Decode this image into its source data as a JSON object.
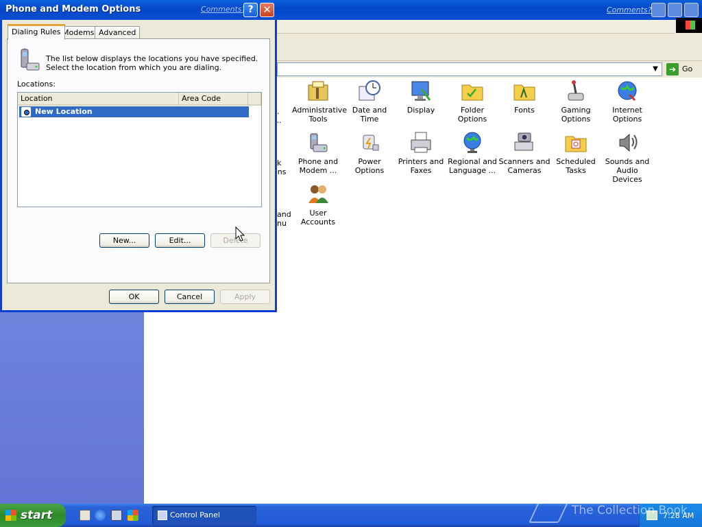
{
  "control_panel": {
    "comments_link": "Comments?",
    "address_go_label": "Go",
    "items": [
      {
        "label": "Administrative Tools",
        "icon": "administrative-tools-icon"
      },
      {
        "label": "Date and Time",
        "icon": "date-time-icon"
      },
      {
        "label": "Display",
        "icon": "display-icon"
      },
      {
        "label": "Folder Options",
        "icon": "folder-options-icon"
      },
      {
        "label": "Fonts",
        "icon": "fonts-icon"
      },
      {
        "label": "Gaming Options",
        "icon": "gaming-options-icon"
      },
      {
        "label": "Internet Options",
        "icon": "internet-options-icon"
      },
      {
        "label": "Phone and Modem ...",
        "icon": "phone-modem-icon"
      },
      {
        "label": "Power Options",
        "icon": "power-options-icon"
      },
      {
        "label": "Printers and Faxes",
        "icon": "printers-faxes-icon"
      },
      {
        "label": "Regional and Language ...",
        "icon": "regional-language-icon"
      },
      {
        "label": "Scanners and Cameras",
        "icon": "scanners-cameras-icon"
      },
      {
        "label": "Scheduled Tasks",
        "icon": "scheduled-tasks-icon"
      },
      {
        "label": "Sounds and Audio Devices",
        "icon": "sounds-audio-icon"
      },
      {
        "label": "User Accounts",
        "icon": "user-accounts-icon"
      }
    ],
    "partial_labels": {
      "row1": ".",
      "row1b": "...",
      "row2a": "k",
      "row2b": "ons",
      "row3a": "and",
      "row3b": "nu"
    }
  },
  "dialog": {
    "title": "Phone and Modem Options",
    "comments_link": "Comments?",
    "help_label": "?",
    "close_label": "✕",
    "tabs": [
      "Dialing Rules",
      "Modems",
      "Advanced"
    ],
    "description": "The list below displays the locations you have specified. Select the location from which you are dialing.",
    "locations_label": "Locations:",
    "columns": [
      "Location",
      "Area Code"
    ],
    "rows": [
      {
        "location": "New Location",
        "area_code": ""
      }
    ],
    "buttons": {
      "new": "New...",
      "edit": "Edit...",
      "delete": "Delete",
      "ok": "OK",
      "cancel": "Cancel",
      "apply": "Apply"
    }
  },
  "taskbar": {
    "start_label": "start",
    "task_label": "Control Panel",
    "clock": "7:28 AM"
  },
  "watermark": "The Collection Book",
  "colors": {
    "selection": "#316ac5",
    "title_blue": "#0a4fd1",
    "start_green": "#2d8a2a",
    "sidebar": "#6b82dd"
  }
}
